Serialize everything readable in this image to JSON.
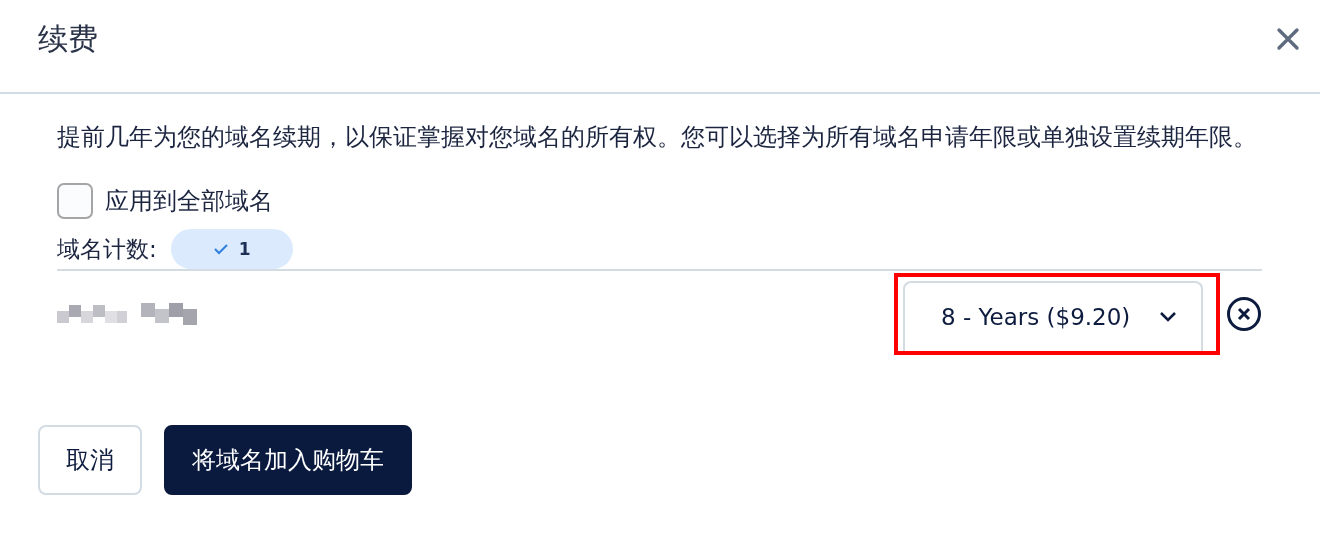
{
  "dialog": {
    "title": "续费"
  },
  "description": "提前几年为您的域名续期，以保证掌握对您域名的所有权。您可以选择为所有域名申请年限或单独设置续期年限。",
  "apply_all": {
    "label": "应用到全部域名",
    "checked": false
  },
  "domain_count": {
    "label": "域名计数:",
    "badge": "1"
  },
  "domains": [
    {
      "kind": "blurred",
      "term": "8 - Years ($9.20)",
      "highlighted": true
    }
  ],
  "buttons": [
    {
      "label": "取消",
      "kind": "secondary"
    },
    {
      "label": "将域名加入购物车",
      "kind": "primary"
    }
  ]
}
